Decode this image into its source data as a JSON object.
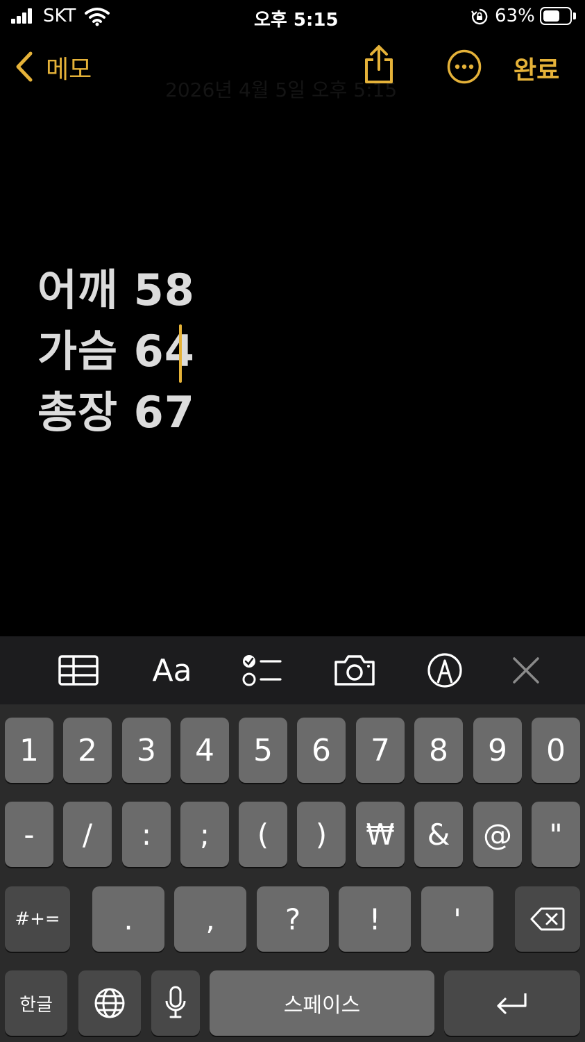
{
  "status_bar": {
    "carrier": "SKT",
    "time": "오후 5:15",
    "battery_percent": "63%",
    "battery_level": 0.63
  },
  "nav": {
    "back_label": "메모",
    "done_label": "완료",
    "faded_date": "2026년 4월 5일 오후 5:15"
  },
  "note": {
    "lines": [
      "어깨 58",
      "가슴 64",
      "총장 67"
    ]
  },
  "toolbar": {
    "items": [
      "table-icon",
      "format-icon",
      "checklist-icon",
      "camera-icon",
      "markup-icon",
      "close-icon"
    ],
    "format_label": "Aa"
  },
  "keyboard": {
    "row1": [
      "1",
      "2",
      "3",
      "4",
      "5",
      "6",
      "7",
      "8",
      "9",
      "0"
    ],
    "row2": [
      "-",
      "/",
      ":",
      ";",
      "(",
      ")",
      "₩",
      "&",
      "@",
      "\""
    ],
    "row3_mode": "#+=",
    "row3": [
      ".",
      ",",
      "?",
      "!",
      "'"
    ],
    "row4_lang": "한글",
    "row4_space": "스페이스"
  },
  "colors": {
    "accent": "#e5b239",
    "background": "#000000",
    "toolbar_bg": "#1c1c1e",
    "key_bg": "#6b6b6b",
    "key_dark_bg": "#484848"
  }
}
